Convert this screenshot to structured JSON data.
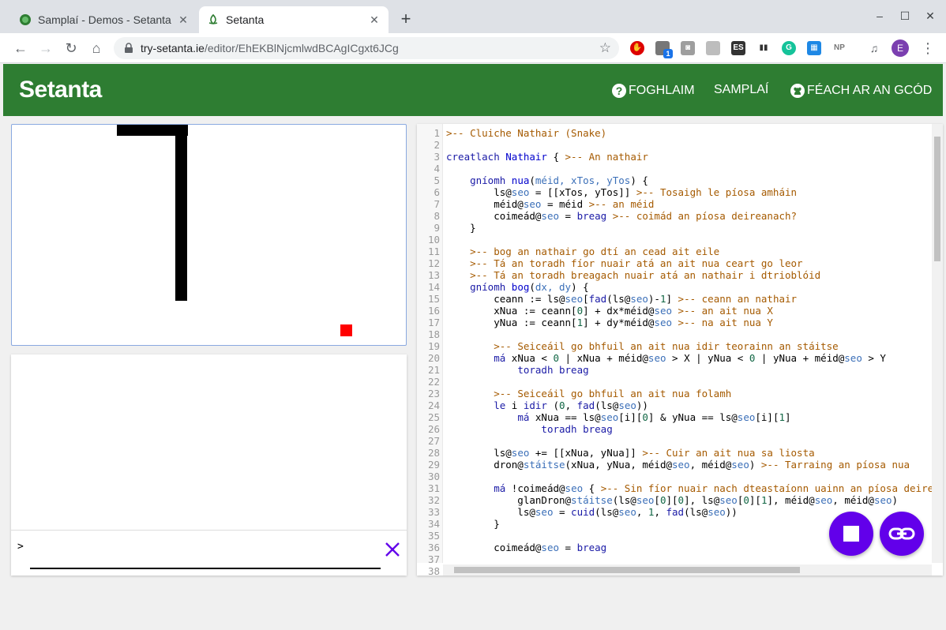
{
  "browser": {
    "tabs": [
      {
        "label": "Samplaí - Demos - Setanta",
        "active": false
      },
      {
        "label": "Setanta",
        "active": true
      }
    ],
    "new_tab_symbol": "+",
    "url_host": "try-setanta.ie",
    "url_path": "/editor/EhEKBlNjcmlwdBCAgICgxt6JCg",
    "profile_initial": "E",
    "extension_badge": "1",
    "extensions": [
      "ES",
      "NP"
    ]
  },
  "app": {
    "brand": "Setanta",
    "nav": {
      "learn": "FOGHLAIM",
      "samples": "SAMPLAÍ",
      "code": "FÉACH AR AN GCÓD"
    }
  },
  "console": {
    "prompt": ">",
    "input_value": ""
  },
  "editor": {
    "lines": [
      {
        "n": "1",
        "tokens": [
          [
            "cm",
            ">-- Cluiche Nathair (Snake)"
          ]
        ]
      },
      {
        "n": "2",
        "tokens": []
      },
      {
        "n": "3",
        "tokens": [
          [
            "kw",
            "creatlach"
          ],
          [
            "code",
            " "
          ],
          [
            "fn",
            "Nathair"
          ],
          [
            "code",
            " { "
          ],
          [
            "cm",
            ">-- An nathair"
          ]
        ]
      },
      {
        "n": "4",
        "tokens": []
      },
      {
        "n": "5",
        "tokens": [
          [
            "code",
            "    "
          ],
          [
            "kw",
            "gníomh"
          ],
          [
            "code",
            " "
          ],
          [
            "fn",
            "nua"
          ],
          [
            "code",
            "("
          ],
          [
            "vs",
            "méid, xTos, yTos"
          ],
          [
            "code",
            ") {"
          ]
        ]
      },
      {
        "n": "6",
        "tokens": [
          [
            "code",
            "        ls@"
          ],
          [
            "vs",
            "seo"
          ],
          [
            "code",
            " = [[xTos, yTos]] "
          ],
          [
            "cm",
            ">-- Tosaigh le píosa amháin"
          ]
        ]
      },
      {
        "n": "7",
        "tokens": [
          [
            "code",
            "        méid@"
          ],
          [
            "vs",
            "seo"
          ],
          [
            "code",
            " = méid "
          ],
          [
            "cm",
            ">-- an méid"
          ]
        ]
      },
      {
        "n": "8",
        "tokens": [
          [
            "code",
            "        coimeád@"
          ],
          [
            "vs",
            "seo"
          ],
          [
            "code",
            " = "
          ],
          [
            "kw",
            "breag"
          ],
          [
            "code",
            " "
          ],
          [
            "cm",
            ">-- coimád an píosa deireanach?"
          ]
        ]
      },
      {
        "n": "9",
        "tokens": [
          [
            "code",
            "    }"
          ]
        ]
      },
      {
        "n": "10",
        "tokens": []
      },
      {
        "n": "11",
        "tokens": [
          [
            "code",
            "    "
          ],
          [
            "cm",
            ">-- bog an nathair go dtí an cead ait eile"
          ]
        ]
      },
      {
        "n": "12",
        "tokens": [
          [
            "code",
            "    "
          ],
          [
            "cm",
            ">-- Tá an toradh fíor nuair atá an ait nua ceart go leor"
          ]
        ]
      },
      {
        "n": "13",
        "tokens": [
          [
            "code",
            "    "
          ],
          [
            "cm",
            ">-- Tá an toradh breagach nuair atá an nathair i dtrioblóid"
          ]
        ]
      },
      {
        "n": "14",
        "tokens": [
          [
            "code",
            "    "
          ],
          [
            "kw",
            "gníomh"
          ],
          [
            "code",
            " "
          ],
          [
            "fn",
            "bog"
          ],
          [
            "code",
            "("
          ],
          [
            "vs",
            "dx, dy"
          ],
          [
            "code",
            ") {"
          ]
        ]
      },
      {
        "n": "15",
        "tokens": [
          [
            "code",
            "        ceann := ls@"
          ],
          [
            "vs",
            "seo"
          ],
          [
            "code",
            "["
          ],
          [
            "kw",
            "fad"
          ],
          [
            "code",
            "(ls@"
          ],
          [
            "vs",
            "seo"
          ],
          [
            "code",
            ")-"
          ],
          [
            "nm",
            "1"
          ],
          [
            "code",
            "] "
          ],
          [
            "cm",
            ">-- ceann an nathair"
          ]
        ]
      },
      {
        "n": "16",
        "tokens": [
          [
            "code",
            "        xNua := ceann["
          ],
          [
            "nm",
            "0"
          ],
          [
            "code",
            "] + dx*méid@"
          ],
          [
            "vs",
            "seo"
          ],
          [
            "code",
            " "
          ],
          [
            "cm",
            ">-- an ait nua X"
          ]
        ]
      },
      {
        "n": "17",
        "tokens": [
          [
            "code",
            "        yNua := ceann["
          ],
          [
            "nm",
            "1"
          ],
          [
            "code",
            "] + dy*méid@"
          ],
          [
            "vs",
            "seo"
          ],
          [
            "code",
            " "
          ],
          [
            "cm",
            ">-- na ait nua Y"
          ]
        ]
      },
      {
        "n": "18",
        "tokens": []
      },
      {
        "n": "19",
        "tokens": [
          [
            "code",
            "        "
          ],
          [
            "cm",
            ">-- Seiceáil go bhfuil an ait nua idir teorainn an stáitse"
          ]
        ]
      },
      {
        "n": "20",
        "tokens": [
          [
            "code",
            "        "
          ],
          [
            "kw",
            "má"
          ],
          [
            "code",
            " xNua < "
          ],
          [
            "nm",
            "0"
          ],
          [
            "code",
            " | xNua + méid@"
          ],
          [
            "vs",
            "seo"
          ],
          [
            "code",
            " > X | yNua < "
          ],
          [
            "nm",
            "0"
          ],
          [
            "code",
            " | yNua + méid@"
          ],
          [
            "vs",
            "seo"
          ],
          [
            "code",
            " > Y"
          ]
        ]
      },
      {
        "n": "21",
        "tokens": [
          [
            "code",
            "            "
          ],
          [
            "kw",
            "toradh"
          ],
          [
            "code",
            " "
          ],
          [
            "kw",
            "breag"
          ]
        ]
      },
      {
        "n": "22",
        "tokens": []
      },
      {
        "n": "23",
        "tokens": [
          [
            "code",
            "        "
          ],
          [
            "cm",
            ">-- Seiceáil go bhfuil an ait nua folamh"
          ]
        ]
      },
      {
        "n": "24",
        "tokens": [
          [
            "code",
            "        "
          ],
          [
            "kw",
            "le"
          ],
          [
            "code",
            " i "
          ],
          [
            "kw",
            "idir"
          ],
          [
            "code",
            " ("
          ],
          [
            "nm",
            "0"
          ],
          [
            "code",
            ", "
          ],
          [
            "kw",
            "fad"
          ],
          [
            "code",
            "(ls@"
          ],
          [
            "vs",
            "seo"
          ],
          [
            "code",
            "))"
          ]
        ]
      },
      {
        "n": "25",
        "tokens": [
          [
            "code",
            "            "
          ],
          [
            "kw",
            "má"
          ],
          [
            "code",
            " xNua == ls@"
          ],
          [
            "vs",
            "seo"
          ],
          [
            "code",
            "[i]["
          ],
          [
            "nm",
            "0"
          ],
          [
            "code",
            "] & yNua == ls@"
          ],
          [
            "vs",
            "seo"
          ],
          [
            "code",
            "[i]["
          ],
          [
            "nm",
            "1"
          ],
          [
            "code",
            "]"
          ]
        ]
      },
      {
        "n": "26",
        "tokens": [
          [
            "code",
            "                "
          ],
          [
            "kw",
            "toradh"
          ],
          [
            "code",
            " "
          ],
          [
            "kw",
            "breag"
          ]
        ]
      },
      {
        "n": "27",
        "tokens": []
      },
      {
        "n": "28",
        "tokens": [
          [
            "code",
            "        ls@"
          ],
          [
            "vs",
            "seo"
          ],
          [
            "code",
            " += [[xNua, yNua]] "
          ],
          [
            "cm",
            ">-- Cuir an ait nua sa liosta"
          ]
        ]
      },
      {
        "n": "29",
        "tokens": [
          [
            "code",
            "        dron@"
          ],
          [
            "vs",
            "stáitse"
          ],
          [
            "code",
            "(xNua, yNua, méid@"
          ],
          [
            "vs",
            "seo"
          ],
          [
            "code",
            ", méid@"
          ],
          [
            "vs",
            "seo"
          ],
          [
            "code",
            ") "
          ],
          [
            "cm",
            ">-- Tarraing an píosa nua"
          ]
        ]
      },
      {
        "n": "30",
        "tokens": []
      },
      {
        "n": "31",
        "tokens": [
          [
            "code",
            "        "
          ],
          [
            "kw",
            "má"
          ],
          [
            "code",
            " !coimeád@"
          ],
          [
            "vs",
            "seo"
          ],
          [
            "code",
            " { "
          ],
          [
            "cm",
            ">-- Sin fíor nuair nach dteastaíonn uainn an píosa deireanach"
          ]
        ]
      },
      {
        "n": "32",
        "tokens": [
          [
            "code",
            "            glanDron@"
          ],
          [
            "vs",
            "stáitse"
          ],
          [
            "code",
            "(ls@"
          ],
          [
            "vs",
            "seo"
          ],
          [
            "code",
            "["
          ],
          [
            "nm",
            "0"
          ],
          [
            "code",
            "]["
          ],
          [
            "nm",
            "0"
          ],
          [
            "code",
            "], ls@"
          ],
          [
            "vs",
            "seo"
          ],
          [
            "code",
            "["
          ],
          [
            "nm",
            "0"
          ],
          [
            "code",
            "]["
          ],
          [
            "nm",
            "1"
          ],
          [
            "code",
            "], méid@"
          ],
          [
            "vs",
            "seo"
          ],
          [
            "code",
            ", méid@"
          ],
          [
            "vs",
            "seo"
          ],
          [
            "code",
            ")"
          ]
        ]
      },
      {
        "n": "33",
        "tokens": [
          [
            "code",
            "            ls@"
          ],
          [
            "vs",
            "seo"
          ],
          [
            "code",
            " = "
          ],
          [
            "kw",
            "cuid"
          ],
          [
            "code",
            "(ls@"
          ],
          [
            "vs",
            "seo"
          ],
          [
            "code",
            ", "
          ],
          [
            "nm",
            "1"
          ],
          [
            "code",
            ", "
          ],
          [
            "kw",
            "fad"
          ],
          [
            "code",
            "(ls@"
          ],
          [
            "vs",
            "seo"
          ],
          [
            "code",
            "))"
          ]
        ]
      },
      {
        "n": "34",
        "tokens": [
          [
            "code",
            "        }"
          ]
        ]
      },
      {
        "n": "35",
        "tokens": []
      },
      {
        "n": "36",
        "tokens": [
          [
            "code",
            "        coimeád@"
          ],
          [
            "vs",
            "seo"
          ],
          [
            "code",
            " = "
          ],
          [
            "kw",
            "breag"
          ]
        ]
      },
      {
        "n": "37",
        "tokens": []
      },
      {
        "n": "38",
        "tokens": []
      }
    ]
  },
  "icons": {
    "stop": "stop-icon",
    "share": "link-icon",
    "clear": "close-icon"
  }
}
